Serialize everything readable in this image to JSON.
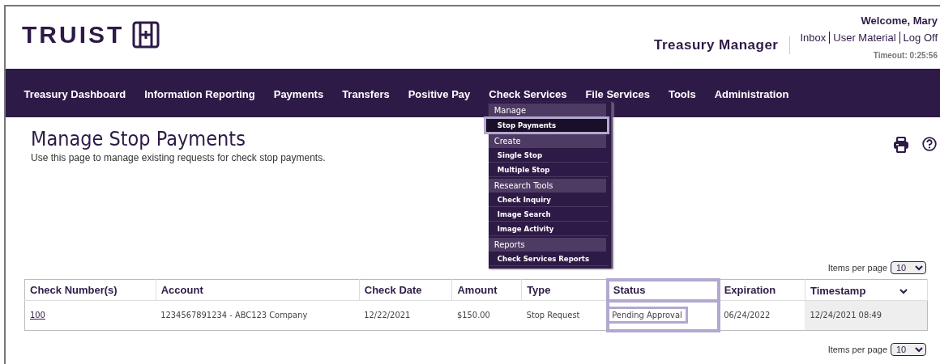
{
  "header": {
    "logo": "TRUIST",
    "welcome": "Welcome, Mary",
    "app_title": "Treasury Manager",
    "links": [
      "Inbox",
      "User Material",
      "Log Off"
    ],
    "timeout": "Timeout: 0:25:56"
  },
  "nav": {
    "items": [
      {
        "label": "Treasury Dashboard"
      },
      {
        "label": "Information Reporting"
      },
      {
        "label": "Payments"
      },
      {
        "label": "Transfers"
      },
      {
        "label": "Positive Pay"
      },
      {
        "label": "Check Services",
        "menu": {
          "groups": [
            {
              "title": "Manage",
              "items": [
                {
                  "label": "Stop Payments",
                  "selected": true
                }
              ]
            },
            {
              "title": "Create",
              "items": [
                {
                  "label": "Single Stop",
                  "selected": false
                },
                {
                  "label": "Multiple Stop",
                  "selected": false
                }
              ]
            },
            {
              "title": "Research Tools",
              "items": [
                {
                  "label": "Check Inquiry",
                  "selected": false
                },
                {
                  "label": "Image Search",
                  "selected": false
                },
                {
                  "label": "Image Activity",
                  "selected": false
                }
              ]
            },
            {
              "title": "Reports",
              "items": [
                {
                  "label": "Check Services Reports",
                  "selected": false
                }
              ]
            }
          ]
        }
      },
      {
        "label": "File Services"
      },
      {
        "label": "Tools"
      },
      {
        "label": "Administration"
      }
    ]
  },
  "page": {
    "title": "Manage Stop Payments",
    "description": "Use this page to manage existing requests for check stop payments."
  },
  "pager_top": {
    "label": "Items per page",
    "value": "10"
  },
  "table": {
    "columns": [
      {
        "label": "Check Number(s)",
        "highlighted": false,
        "sorted": false
      },
      {
        "label": "Account",
        "highlighted": false,
        "sorted": false
      },
      {
        "label": "Check Date",
        "highlighted": false,
        "sorted": false
      },
      {
        "label": "Amount",
        "highlighted": false,
        "sorted": false
      },
      {
        "label": "Type",
        "highlighted": false,
        "sorted": false
      },
      {
        "label": "Status",
        "highlighted": true,
        "sorted": false
      },
      {
        "label": "Expiration",
        "highlighted": false,
        "sorted": false
      },
      {
        "label": "Timestamp",
        "highlighted": false,
        "sorted": true
      }
    ],
    "rows": [
      {
        "cells": [
          {
            "text": "100",
            "kind": "link",
            "highlighted": false
          },
          {
            "text": "1234567891234 - ABC123 Company",
            "kind": "text",
            "highlighted": false
          },
          {
            "text": "12/22/2021",
            "kind": "text",
            "highlighted": false
          },
          {
            "text": "$150.00",
            "kind": "text",
            "highlighted": false
          },
          {
            "text": "Stop Request",
            "kind": "text",
            "highlighted": false
          },
          {
            "text": "Pending Approval",
            "kind": "text",
            "highlighted": true
          },
          {
            "text": "06/24/2022",
            "kind": "text",
            "highlighted": false
          },
          {
            "text": "12/24/2021 08:49",
            "kind": "text",
            "highlighted": false
          }
        ]
      }
    ]
  },
  "pager_bottom": {
    "label": "Items per page",
    "value": "10"
  }
}
